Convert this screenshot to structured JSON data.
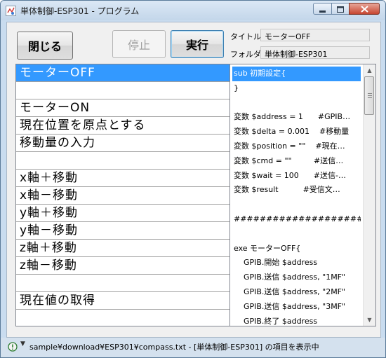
{
  "window": {
    "title": "単体制御-ESP301 - プログラム"
  },
  "toolbar": {
    "close_label": "閉じる",
    "stop_label": "停止",
    "run_label": "実行",
    "title_label": "タイトル",
    "title_value": "モーターOFF",
    "folder_label": "フォルダ",
    "folder_value": "単体制御-ESP301"
  },
  "commands": [
    {
      "label": "モーターOFF",
      "selected": true
    },
    {
      "label": ""
    },
    {
      "label": "モーターON"
    },
    {
      "label": "現在位置を原点とする"
    },
    {
      "label": "移動量の入力"
    },
    {
      "label": ""
    },
    {
      "label": "x軸＋移動"
    },
    {
      "label": "x軸－移動"
    },
    {
      "label": "y軸＋移動"
    },
    {
      "label": "y軸－移動"
    },
    {
      "label": "z軸＋移動"
    },
    {
      "label": "z軸－移動"
    },
    {
      "label": ""
    },
    {
      "label": "現在値の取得"
    },
    {
      "label": ""
    }
  ],
  "code": [
    {
      "text": "sub 初期設定{",
      "selected": true
    },
    {
      "text": "}"
    },
    {
      "text": ""
    },
    {
      "text": "変数 $address = 1      #GPIB…"
    },
    {
      "text": "変数 $delta = 0.001    #移動量"
    },
    {
      "text": "変数 $position = \"\"    #現在…"
    },
    {
      "text": "変数 $cmd = \"\"         #送信…"
    },
    {
      "text": "変数 $wait = 100      #送信-…"
    },
    {
      "text": "変数 $result          #受信文…"
    },
    {
      "text": ""
    },
    {
      "text": "##################### プロ…"
    },
    {
      "text": ""
    },
    {
      "text": "exe モーターOFF{"
    },
    {
      "text": "    GPIB.開始 $address"
    },
    {
      "text": "    GPIB.送信 $address, \"1MF\""
    },
    {
      "text": "    GPIB.送信 $address, \"2MF\""
    },
    {
      "text": "    GPIB.送信 $address, \"3MF\""
    },
    {
      "text": "    GPIB.終了 $address"
    }
  ],
  "status": {
    "text": "sample¥download¥ESP301¥compass.txt - [単体制御-ESP301] の項目を表示中"
  },
  "icons": {
    "app": "program-window-icon",
    "minimize": "minimize-icon",
    "maximize": "maximize-icon",
    "close": "close-icon",
    "status": "info-icon",
    "scroll_up": "scroll-up-arrow-icon",
    "scroll_down": "scroll-down-arrow-icon"
  },
  "colors": {
    "selection": "#3399ff",
    "close_button": "#c7452f",
    "title_bar": "#c9dcef"
  }
}
